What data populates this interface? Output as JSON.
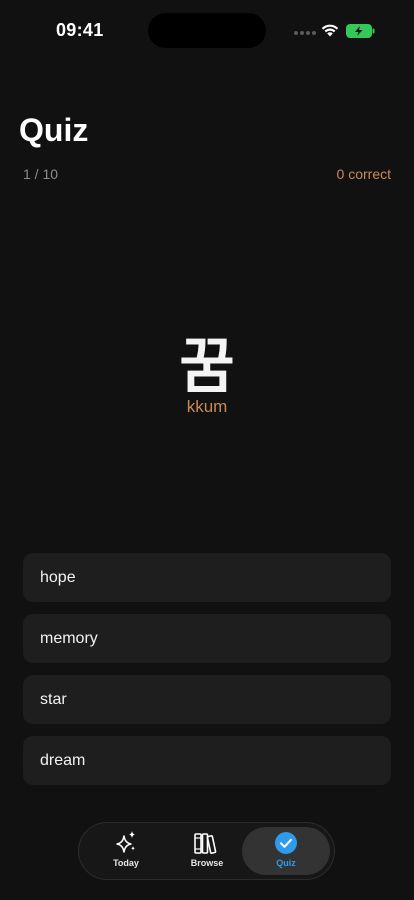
{
  "status_bar": {
    "time": "09:41"
  },
  "quiz": {
    "title": "Quiz",
    "progress": "1 / 10",
    "correct_count": "0 correct",
    "word": "꿈",
    "romanization": "kkum",
    "options": [
      "hope",
      "memory",
      "star",
      "dream"
    ]
  },
  "tab_bar": {
    "tabs": [
      {
        "label": "Today",
        "icon": "sparkles-icon"
      },
      {
        "label": "Browse",
        "icon": "books-icon"
      },
      {
        "label": "Quiz",
        "icon": "checkmark-circle-icon",
        "active": true
      }
    ]
  },
  "colors": {
    "background": "#111111",
    "accent": "#c98a5a",
    "active_tab": "#2f9bea",
    "battery": "#34c759"
  }
}
